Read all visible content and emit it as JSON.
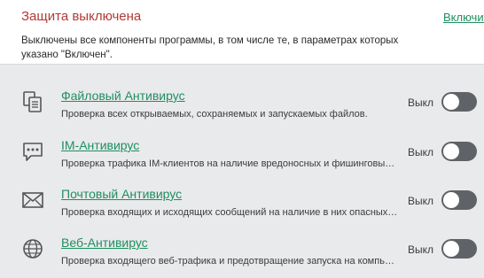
{
  "status": {
    "title": "Защита выключена",
    "enable_link": "Включить",
    "description": "Выключены все компоненты программы, в том числе те, в параметрах которых указано \"Включен\"."
  },
  "components": [
    {
      "icon": "file-documents-icon",
      "title": "Файловый Антивирус",
      "description": "Проверка всех открываемых, сохраняемых и запускаемых файлов.",
      "state": "Выкл",
      "enabled": false
    },
    {
      "icon": "chat-bubble-icon",
      "title": "IM-Антивирус",
      "description": "Проверка трафика IM-клиентов на наличие вредоносных и фишинговых ссылок.",
      "state": "Выкл",
      "enabled": false
    },
    {
      "icon": "envelope-icon",
      "title": "Почтовый Антивирус",
      "description": "Проверка входящих и исходящих сообщений на наличие в них опасных объектов.",
      "state": "Выкл",
      "enabled": false
    },
    {
      "icon": "globe-icon",
      "title": "Веб-Антивирус",
      "description": "Проверка входящего веб-трафика и предотвращение запуска на компьютере опасных скриптов.",
      "state": "Выкл",
      "enabled": false
    }
  ],
  "colors": {
    "alert": "#b23a34",
    "link": "#1f8f5f",
    "toggle_off": "#5f6368",
    "background": "#e9eaec"
  }
}
